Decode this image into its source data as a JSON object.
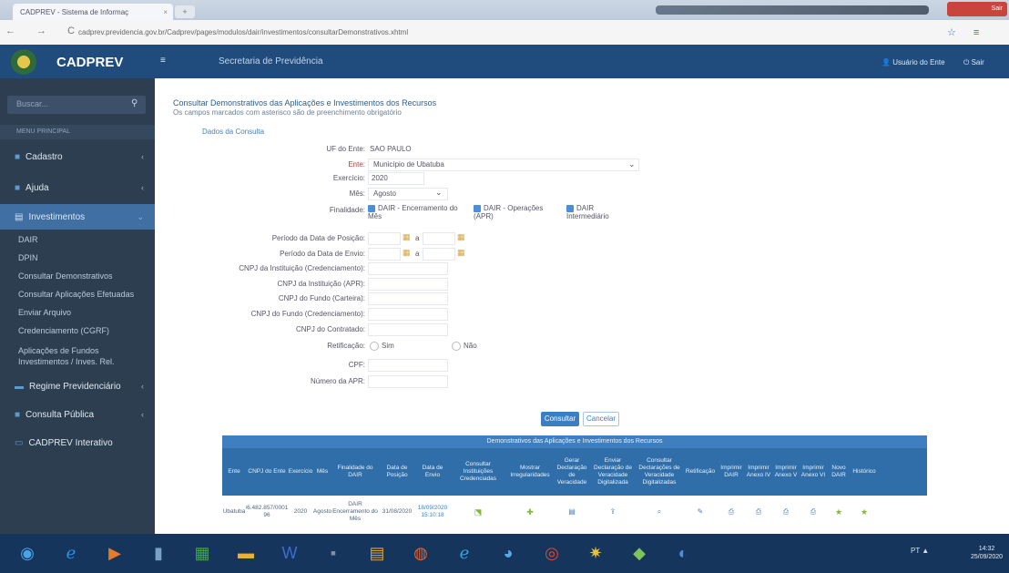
{
  "browser": {
    "tab_title": "CADPREV - Sistema de Informaç",
    "tab_close": "×",
    "new_tab": "+",
    "nav_icons": "← →  C",
    "url": "cadprev.previdencia.gov.br/Cadprev/pages/modulos/dair/investimentos/consultarDemonstrativos.xhtml",
    "window_close": "Sair"
  },
  "header": {
    "app_name": "CADPREV",
    "menu_icon": "≡",
    "secretaria": "Secretaria de Previdência",
    "user": "Usuário do Ente",
    "exit": "Sair"
  },
  "sidebar": {
    "search_placeholder": "Buscar...",
    "section": "MENU PRINCIPAL",
    "items": [
      {
        "label": "Cadastro",
        "icon": "folder-icon"
      },
      {
        "label": "Ajuda",
        "icon": "help-icon"
      },
      {
        "label": "Investimentos",
        "icon": "chart-icon"
      }
    ],
    "subitems": [
      "DAIR",
      "DPIN",
      "Consultar Demonstrativos",
      "Consultar Aplicações Efetuadas",
      "Enviar Arquivo",
      "Credenciamento (CGRF)",
      "Aplicações de Fundos",
      "Investimentos / Inves. Rel."
    ],
    "items_lower": [
      {
        "label": "Regime Previdenciário",
        "icon": "shield-icon"
      },
      {
        "label": "Consulta Pública",
        "icon": "search-icon"
      },
      {
        "label": "CADPREV Interativo",
        "icon": "monitor-icon"
      }
    ]
  },
  "page": {
    "title": "Consultar Demonstrativos das Aplicações e Investimentos dos Recursos",
    "subtitle": "Os campos marcados com asterisco são de preenchimento obrigatório",
    "section": "Dados da Consulta"
  },
  "form": {
    "uf_label": "UF do Ente:",
    "uf_value": "SAO PAULO",
    "ente_label": "Ente:",
    "ente_value": "Município de Ubatuba",
    "exercicio_label": "Exercício:",
    "exercicio_value": "2020",
    "mes_label": "Mês:",
    "mes_value": "Agosto",
    "finalidade_label": "Finalidade:",
    "finalidade_opts": [
      "DAIR - Encerramento do Mês",
      "DAIR - Operações (APR)",
      "DAIR Intermediário"
    ],
    "periodo_posicao_label": "Período da Data de Posição:",
    "periodo_envio_label": "Período da Data de Envio:",
    "periodo_sep": "a",
    "cnpj_credenciamento_label": "CNPJ da Instituição (Credenciamento):",
    "cnpj_instituicao_label": "CNPJ da Instituição (APR):",
    "cnpj_fundo_label": "CNPJ do Fundo (Carteira):",
    "cnpj_fundo_cred_label": "CNPJ do Fundo (Credenciamento):",
    "cnpj_contratado_label": "CNPJ do Contratado:",
    "retificacao_label": "Retificação:",
    "ret_sim": "Sim",
    "ret_nao": "Não",
    "cpf_label": "CPF:",
    "apr_label": "Número da APR:",
    "consultar": "Consultar",
    "limpar": "Cancelar"
  },
  "table": {
    "caption": "Demonstrativos das Aplicações e Investimentos dos Recursos",
    "headers": [
      "Ente",
      "CNPJ do Ente",
      "Exercício",
      "Mês",
      "Finalidade do DAIR",
      "Data de Posição",
      "Data de Envio",
      "Consultar Instituições Credenciadas",
      "Mostrar Irregularidades",
      "Gerar Declaração de Veracidade",
      "Enviar Declaração de Veracidade Digitalizada",
      "Consultar Declarações de Veracidade Digitalizadas",
      "Retificação",
      "Imprimir DAIR",
      "Imprimir Anexo IV",
      "Imprimir Anexo V",
      "Imprimir Anexo VI",
      "Novo DAIR",
      "Histórico"
    ],
    "row": [
      "Ubatuba",
      "46.482.857/0001-96",
      "2020",
      "Agosto",
      "DAIR Encerramento do Mês",
      "31/08/2020",
      "18/09/2020 15:10:18"
    ]
  },
  "taskbar": {
    "tray": "PT ▲",
    "time": "14:32",
    "date": "25/09/2020"
  },
  "colors": {
    "header": "#1f4c7d",
    "sidebar": "#2c3e50",
    "accent": "#3a7fc4"
  }
}
